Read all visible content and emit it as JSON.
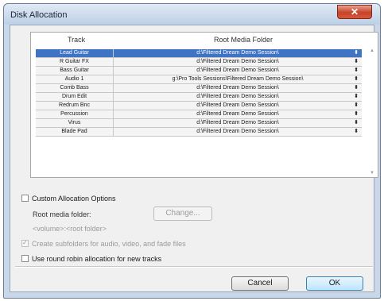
{
  "window": {
    "title": "Disk Allocation",
    "close_glyph": "✕"
  },
  "table": {
    "columns": {
      "track": "Track",
      "folder": "Root Media Folder"
    },
    "spin_glyph": "⬍",
    "rows": [
      {
        "track": "Lead Guitar",
        "folder": "d:\\Filtered Dream Demo Session\\"
      },
      {
        "track": "R Guitar FX",
        "folder": "d:\\Filtered Dream Demo Session\\"
      },
      {
        "track": "Bass Guitar",
        "folder": "d:\\Filtered Dream Demo Session\\"
      },
      {
        "track": "Audio 1",
        "folder": "g:\\Pro Tools Sessions\\Filtered Dream Demo Session\\"
      },
      {
        "track": "Comb Bass",
        "folder": "d:\\Filtered Dream Demo Session\\"
      },
      {
        "track": "Drum Edit",
        "folder": "d:\\Filtered Dream Demo Session\\"
      },
      {
        "track": "Redrum Bnc",
        "folder": "d:\\Filtered Dream Demo Session\\"
      },
      {
        "track": "Percussion",
        "folder": "d:\\Filtered Dream Demo Session\\"
      },
      {
        "track": "Virus",
        "folder": "d:\\Filtered Dream Demo Session\\"
      },
      {
        "track": "Blade Pad",
        "folder": "d:\\Filtered Dream Demo Session\\"
      }
    ],
    "scroll_up_glyph": "▲",
    "scroll_down_glyph": "▼"
  },
  "options": {
    "custom_allocation": "Custom Allocation Options",
    "root_media_folder": "Root media folder:",
    "change_button": "Change...",
    "path_template": "<volume>:<root folder>",
    "create_subfolders": "Create subfolders for audio, video, and fade files",
    "round_robin": "Use round robin allocation for new tracks"
  },
  "buttons": {
    "cancel": "Cancel",
    "ok": "OK"
  },
  "colors": {
    "selection": "#3f73c4",
    "title_bar": "#c9d7e8",
    "close": "#c6432b"
  }
}
